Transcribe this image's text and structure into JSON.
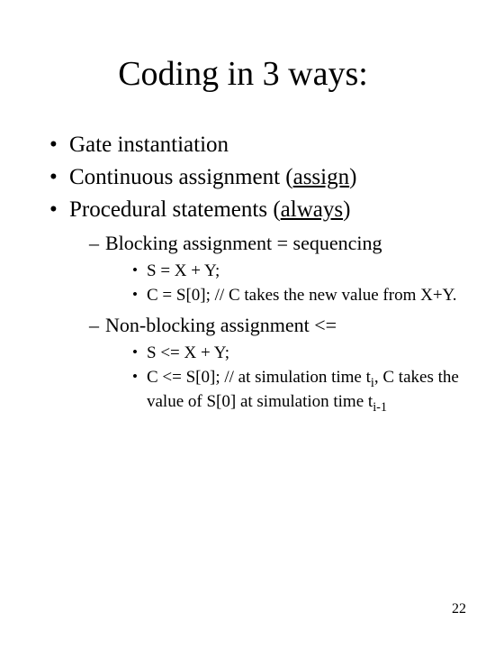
{
  "title": "Coding in 3 ways:",
  "l1": {
    "a": "Gate instantiation",
    "b_pre": "Continuous assignment (",
    "b_u": "assign",
    "b_post": ")",
    "c_pre": "Procedural statements (",
    "c_u": "always",
    "c_post": ")"
  },
  "l2": {
    "a": "Blocking assignment  = sequencing",
    "b": "Non-blocking assignment  <="
  },
  "l3a": {
    "a": "S = X + Y;",
    "b": "C = S[0]; // C takes the new value from X+Y."
  },
  "l3b": {
    "a": "S <= X + Y;",
    "b_pre": "C <= S[0]; // at simulation time t",
    "b_sub1": "i",
    "b_mid": ", C takes the value of S[0] at simulation time t",
    "b_sub2": "i-1"
  },
  "page": "22"
}
